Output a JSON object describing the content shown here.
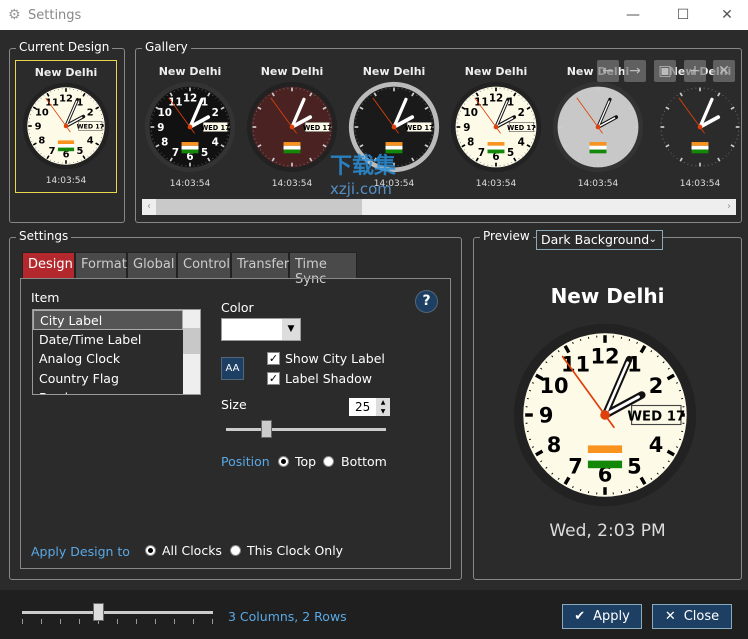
{
  "window": {
    "title": "Settings",
    "icon": "gear-icon",
    "minimize": "—",
    "maximize": "☐",
    "close": "✕"
  },
  "current_design": {
    "label": "Current Design",
    "city": "New Delhi",
    "time": "14:03:54"
  },
  "gallery": {
    "label": "Gallery",
    "items": [
      {
        "city": "New Delhi",
        "time": "14:03:54",
        "style": "dark"
      },
      {
        "city": "New Delhi",
        "time": "14:03:54",
        "style": "maroon"
      },
      {
        "city": "New Delhi",
        "time": "14:03:54",
        "style": "ring"
      },
      {
        "city": "New Delhi",
        "time": "14:03:54",
        "style": "cream"
      },
      {
        "city": "New Delhi",
        "time": "14:03:54",
        "style": "metal"
      },
      {
        "city": "New Delhi",
        "time": "14:03:54",
        "style": "minimal"
      }
    ],
    "tools": [
      {
        "icon": "arrow-left-icon",
        "glyph": "←"
      },
      {
        "icon": "arrow-right-icon",
        "glyph": "→"
      },
      {
        "icon": "save-icon",
        "glyph": "▣"
      },
      {
        "icon": "plus-icon",
        "glyph": "+"
      },
      {
        "icon": "close-icon",
        "glyph": "✕"
      }
    ],
    "scroll_position": 0.0
  },
  "clock": {
    "hour": 14,
    "minute": 3,
    "second": 54,
    "weekday": "WED",
    "day": "17"
  },
  "settings": {
    "label": "Settings",
    "tabs": [
      "Design",
      "Format",
      "Global",
      "Control",
      "Transfer",
      "Time Sync"
    ],
    "active_tab": "Design",
    "item_label": "Item",
    "items": [
      "City Label",
      "Date/Time Label",
      "Analog Clock",
      "Country Flag",
      "Border"
    ],
    "selected_item": "City Label",
    "color_label": "Color",
    "color_value": "#ffffff",
    "font_button": "AA",
    "help": "?",
    "show_city_label": "Show City Label",
    "label_shadow": "Label Shadow",
    "size_label": "Size",
    "size_value": "25",
    "size_slider": 0.25,
    "position_label": "Position",
    "position_top": "Top",
    "position_bottom": "Bottom",
    "position_selected": "Top",
    "apply_to_label": "Apply Design to",
    "apply_all": "All Clocks",
    "apply_this": "This Clock Only",
    "apply_selected": "All Clocks"
  },
  "preview": {
    "label": "Preview",
    "background": "Dark Background",
    "city": "New Delhi",
    "datetime": "Wed, 2:03 PM"
  },
  "footer": {
    "layout_text": "3 Columns, 2 Rows",
    "layout_slider": 0.4,
    "apply": "Apply",
    "close": "Close"
  },
  "watermark": {
    "text": "下载集",
    "url": "xzji.com"
  },
  "colors": {
    "accent_tab": "#b3282d",
    "button": "#1d3f63",
    "link": "#5aa9e6",
    "highlight": "#e5d84a"
  }
}
